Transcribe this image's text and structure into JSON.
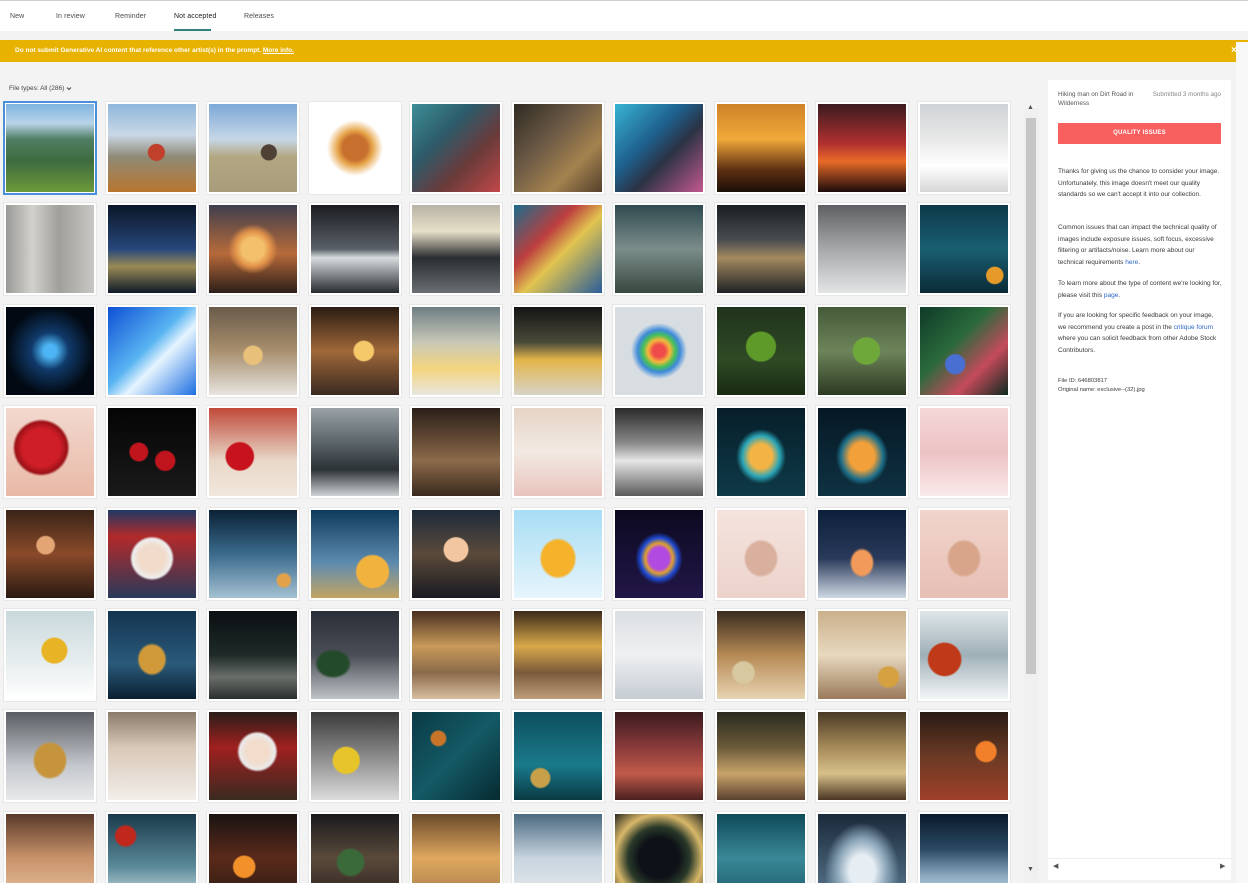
{
  "tabs": [
    {
      "label": "New",
      "active": false
    },
    {
      "label": "In review",
      "active": false
    },
    {
      "label": "Reminder",
      "active": false
    },
    {
      "label": "Not accepted",
      "active": true
    },
    {
      "label": "Releases",
      "active": false
    }
  ],
  "banner": {
    "text": "Do not submit Generative AI content that reference other artist(s) in the prompt.",
    "link": "More info.",
    "close": "×",
    "color": "#e8b200"
  },
  "filter": {
    "label": "File types: All (286)",
    "chevron_icon": "chevron-down-icon"
  },
  "scrollbar": {
    "up_arrow": "▲",
    "down_arrow": "▼"
  },
  "detail": {
    "title": "Hiking man on Dirt Road in Wilderness",
    "submitted": "Submitted 3 months ago",
    "status_button": "QUALITY ISSUES",
    "status_color": "#f86060",
    "p1": "Thanks for giving us the chance to consider your image. Unfortunately, this image doesn't meet our quality standards so we can't accept it into our collection.",
    "p2_text": "Common issues that can impact the technical quality of images include exposure issues, soft focus, excessive filtering or artifacts/noise. Learn more about our technical requirements",
    "p2_link": "here",
    "p3_text": "To learn more about the type of content we're looking for, please visit this",
    "p3_link": "page",
    "p4_a": "If you are looking for specific feedback on your image, we recommend you create a post in the",
    "p4_link": "critique forum",
    "p4_b": "where you can solicit feedback from other Adobe Stock Contributors.",
    "file_id": "File ID: 646803817",
    "original_name": "Original name: exclusive--(32).jpg",
    "scroll_left": "◀",
    "scroll_right": "▶"
  },
  "thumbnails": [
    {
      "subject": "mountain-valley-hiker-dog",
      "bg": "linear-gradient(180deg,#7fb3e0 0%,#b9d4ea 22%,#4f7f63 40%,#3e6b3f 65%,#6c9a3a 100%)"
    },
    {
      "subject": "hiker-with-dog",
      "bg": "radial-gradient(circle at 55% 55%,#c0402c 0 12%,transparent 13%),linear-gradient(180deg,#8fb6dc 0%,#c9d8e6 35%,#8f8a76 60%,#b9762f 100%)"
    },
    {
      "subject": "hiker-on-dirt-road",
      "bg": "radial-gradient(circle at 68% 55%,#4f4135 0 10%,transparent 11%),linear-gradient(180deg,#7da8d8 0%,#c6d7e6 40%,#b3a782 60%,#a79c7c 100%)"
    },
    {
      "subject": "burger-splash",
      "bg": "radial-gradient(circle at 50% 50%,#c7702e 0 20%,#e6a54a 28%,#fff 45%)"
    },
    {
      "subject": "soldier-american-flag",
      "bg": "linear-gradient(135deg,#3d8e96 0%,#2d5b6b 35%,#6a3a3a 65%,#c14848 100%)"
    },
    {
      "subject": "soldier-flag-sepia",
      "bg": "linear-gradient(135deg,#2f2a24 0%,#6d5b45 40%,#a4824f 70%,#54412a 100%)"
    },
    {
      "subject": "soldier-watercolor",
      "bg": "linear-gradient(135deg,#38b4d4 0%,#1e5e8c 40%,#2b3344 60%,#c45890 100%)"
    },
    {
      "subject": "family-sunset-silhouette",
      "bg": "linear-gradient(180deg,#ce8228 0%,#f1a93a 40%,#5d2f12 75%,#1b0f08 100%)"
    },
    {
      "subject": "father-child-sunset",
      "bg": "linear-gradient(180deg,#3b1a1e 0%,#b03030 45%,#e96a28 65%,#1c0c0c 100%)"
    },
    {
      "subject": "man-studio-backdrop",
      "bg": "linear-gradient(180deg,#cfd3d6 0%,#e8e8e8 40%,#ffffff 70%,#d6d6d6 100%)"
    },
    {
      "subject": "wood-snow-backdrop",
      "bg": "linear-gradient(90deg,#9a9a98 0%,#d2d1cd 30%,#a09f9b 60%,#c8c7c3 100%)"
    },
    {
      "subject": "gold-bokeh-water",
      "bg": "linear-gradient(180deg,#0a1628 0%,#27467a 50%,#9a8a55 70%,#0d1a2a 100%)"
    },
    {
      "subject": "crystal-ball-sunset",
      "bg": "radial-gradient(circle at 50% 50%,#f3c06b 0 18%,#e2934a 28%,transparent 40%),linear-gradient(180deg,#3f3f4e 0%,#b76a3a 55%,#2d1f1a 100%)"
    },
    {
      "subject": "fighter-jet",
      "bg": "linear-gradient(180deg,#1a1c20 0%,#5a6068 50%,#d8dde0 60%,#262a2e 100%)"
    },
    {
      "subject": "airliner-runway",
      "bg": "linear-gradient(180deg,#b8b3a5 0%,#e6dfc8 30%,#2a2d31 60%,#6a6e72 100%)"
    },
    {
      "subject": "shipping-containers",
      "bg": "linear-gradient(135deg,#1b6c8c 0%,#bb3e3e 35%,#e2c44f 55%,#2a5d9a 100%)"
    },
    {
      "subject": "old-warplane",
      "bg": "linear-gradient(180deg,#2f4a50 0%,#7b8d8a 50%,#38473f 100%)"
    },
    {
      "subject": "plane-dark-sky",
      "bg": "linear-gradient(180deg,#1a1e22 0%,#4a4d50 40%,#a48a60 60%,#1f2225 100%)"
    },
    {
      "subject": "snow-christmas-stars",
      "bg": "linear-gradient(180deg,#5d5f62 0%,#a6a8aa 50%,#e3e4e5 100%)"
    },
    {
      "subject": "teal-bokeh-gold",
      "bg": "radial-gradient(circle at 85% 80%,#e59a2a 0 8%,transparent 9%),linear-gradient(180deg,#0d3a4a 0%,#1a5e72 50%,#0b2b36 100%)"
    },
    {
      "subject": "blue-light-rings",
      "bg": "radial-gradient(ellipse at 50% 50%,#4db5f5 0 10%,#103a6a 30%,#020912 70%)"
    },
    {
      "subject": "blue-fiber-lights",
      "bg": "linear-gradient(135deg,#0e4fd4 0%,#58b3f2 45%,#e6f5ff 60%,#1d6ee0 100%)"
    },
    {
      "subject": "snow-globe-bokeh",
      "bg": "radial-gradient(circle at 50% 55%,#e8c07a 0 14%,transparent 16%),linear-gradient(180deg,#6a5b4a 0%,#a88f6e 50%,#e7e4df 100%)"
    },
    {
      "subject": "gold-ornament-bokeh",
      "bg": "radial-gradient(circle at 60% 50%,#f5c86a 0 14%,transparent 16%),linear-gradient(180deg,#2a1c12 0%,#a0683a 50%,#3a2a20 100%)"
    },
    {
      "subject": "snowy-trees-forest",
      "bg": "linear-gradient(180deg,#6e7e83 0%,#c8c8b8 40%,#f4d57e 70%,#e8e6df 100%)"
    },
    {
      "subject": "gold-trees-dark",
      "bg": "linear-gradient(180deg,#141414 0%,#4a4a3a 40%,#e3b54a 60%,#d7d3c8 100%)"
    },
    {
      "subject": "rainbow-ornament",
      "bg": "radial-gradient(circle at 50% 50%,#f04b4b 0 10%,#f5b83c 18%,#45c05a 26%,#3d8ad9 34%,#d8dde2 45%)"
    },
    {
      "subject": "moss-heart",
      "bg": "radial-gradient(circle at 50% 45%,#5e9a2a 0 22%,transparent 24%),linear-gradient(180deg,#20331c 0%,#2f4a25 60%,#1a2a14 100%)"
    },
    {
      "subject": "moss-heart-forest",
      "bg": "radial-gradient(circle at 55% 50%,#6ea83a 0 20%,transparent 22%),linear-gradient(180deg,#455a38 0%,#6d845a 50%,#2c3a22 100%)"
    },
    {
      "subject": "pine-ornament",
      "bg": "radial-gradient(circle at 40% 65%,#4a6fd3 0 12%,transparent 14%),linear-gradient(135deg,#0f3a2a 0%,#2a6a3a 40%,#c44a5a 70%,#0c2a1f 100%)"
    },
    {
      "subject": "red-rose",
      "bg": "radial-gradient(circle at 40% 45%,#d01e28 0 26%,#9c1217 36%,transparent 40%),linear-gradient(180deg,#f2d8cf 0%,#e9b9a6 100%)"
    },
    {
      "subject": "roses-dark",
      "bg": "radial-gradient(circle at 35% 50%,#c1151e 0 12%,transparent 14%),radial-gradient(circle at 65% 60%,#c1151e 0 12%,transparent 14%),linear-gradient(180deg,#050505 0%,#1a1a1a 100%)"
    },
    {
      "subject": "rose-bed",
      "bg": "radial-gradient(circle at 35% 55%,#c8121d 0 18%,transparent 20%),linear-gradient(180deg,#c14a3a 0%,#e8d8c8 60%,#f1e7dc 100%)"
    },
    {
      "subject": "snowy-building",
      "bg": "linear-gradient(180deg,#9aa2a6 0%,#5a6368 40%,#2c3236 70%,#cfd3d6 100%)"
    },
    {
      "subject": "horse-carriage",
      "bg": "linear-gradient(180deg,#2a1f18 0%,#6b5038 40%,#8b6a4a 60%,#3a2a1e 100%)"
    },
    {
      "subject": "candles-petals",
      "bg": "linear-gradient(180deg,#e6d4c6 0%,#f2e9e2 50%,#e8c4bd 100%)"
    },
    {
      "subject": "man-paper-bw",
      "bg": "linear-gradient(180deg,#2a2a2a 0%,#8a8a8a 40%,#e6e6e6 60%,#5a5a5a 100%)"
    },
    {
      "subject": "ribbon-christmas-tree",
      "bg": "radial-gradient(ellipse at 50% 55%,#f3b445 0 18%,#2aa6b8 30%,transparent 40%),linear-gradient(180deg,#071e2a 0%,#0e3a48 100%)"
    },
    {
      "subject": "lit-christmas-tree",
      "bg": "radial-gradient(ellipse at 50% 55%,#f2a13a 0 20%,#1c6e8a 34%,transparent 42%),linear-gradient(180deg,#061825 0%,#0f3242 100%)"
    },
    {
      "subject": "pink-room",
      "bg": "linear-gradient(180deg,#f4d8d9 0%,#ecc2c4 50%,#f9eaea 100%)"
    },
    {
      "subject": "girl-with-sparkler",
      "bg": "radial-gradient(circle at 45% 40%,#e3a574 0 12%,transparent 14%),linear-gradient(180deg,#3a2418 0%,#8a4a2a 50%,#2a1a12 100%)"
    },
    {
      "subject": "santa-portrait",
      "bg": "radial-gradient(circle at 50% 55%,#f1dccb 0 20%,#eeeeee 30%,transparent 34%),linear-gradient(180deg,#1f3a64 0%,#b22a2a 30%,#2a3a5a 100%)"
    },
    {
      "subject": "blue-bokeh-snow",
      "bg": "radial-gradient(circle at 85% 80%,#e3a24a 0 6%,transparent 8%),linear-gradient(180deg,#0b2236 0%,#3a6a8c 50%,#a5c1d2 100%)"
    },
    {
      "subject": "gift-box-blue",
      "bg": "radial-gradient(circle at 70% 70%,#f2b23e 0 18%,transparent 20%),linear-gradient(180deg,#0e3b5c 0%,#5d8bb0 60%,#c4a463 100%)"
    },
    {
      "subject": "girl-with-lantern",
      "bg": "radial-gradient(circle at 50% 45%,#f1c6a0 0 18%,transparent 20%),linear-gradient(180deg,#1e2a3a 0%,#5a4a3a 50%,#1a1a22 100%)"
    },
    {
      "subject": "gold-origami-tree",
      "bg": "radial-gradient(ellipse at 50% 55%,#f5b22a 0 26%,transparent 30%),linear-gradient(180deg,#a8ddf4 0%,#e6f5fc 100%)"
    },
    {
      "subject": "neon-tree",
      "bg": "radial-gradient(ellipse at 50% 55%,#b04ae0 0 16%,#e0a030 22%,#1d4ad4 30%,transparent 38%),linear-gradient(180deg,#0c0a20 0%,#221648 100%)"
    },
    {
      "subject": "pink-paper-tree",
      "bg": "radial-gradient(ellipse at 50% 55%,#d9b09e 0 24%,transparent 28%),linear-gradient(180deg,#f4e3dd 0%,#ecd3cb 100%)"
    },
    {
      "subject": "lit-tree-snow",
      "bg": "radial-gradient(ellipse at 50% 60%,#f19a5a 0 16%,transparent 20%),linear-gradient(180deg,#0c1f3a 0%,#2a3a5a 55%,#cfd9e4 100%)"
    },
    {
      "subject": "paper-tree-pink",
      "bg": "radial-gradient(ellipse at 50% 55%,#d8a58a 0 24%,transparent 28%),linear-gradient(180deg,#f1d4cc 0%,#e7bfb4 100%)"
    },
    {
      "subject": "gold-ornament-snow",
      "bg": "radial-gradient(circle at 55% 45%,#e8b426 0 18%,transparent 20%),linear-gradient(180deg,#c9d8dc 0%,#e8eeef 60%,#ffffff 100%)"
    },
    {
      "subject": "gold-tree-blue",
      "bg": "radial-gradient(ellipse at 50% 55%,#d09a3a 0 20%,transparent 24%),linear-gradient(180deg,#133450 0%,#2a5a7a 60%,#0a1f30 100%)"
    },
    {
      "subject": "small-trees-dark",
      "bg": "linear-gradient(180deg,#0b0f12 0%,#1e2a28 50%,#6a6e6a 75%,#2a2e2e 100%)"
    },
    {
      "subject": "tree-night-snow",
      "bg": "radial-gradient(ellipse at 25% 60%,#234a2a 0 16%,transparent 20%),linear-gradient(180deg,#2a2e36 0%,#4a4e56 50%,#bfc4c8 100%)"
    },
    {
      "subject": "gold-bokeh-wood",
      "bg": "linear-gradient(180deg,#4a3020 0%,#c89a5a 40%,#8a6a4a 70%,#d8bfa0 100%)"
    },
    {
      "subject": "gold-bokeh-table",
      "bg": "linear-gradient(180deg,#3a2a1a 0%,#d8a84a 40%,#7a5a3a 70%,#bf9f7a 100%)"
    },
    {
      "subject": "reindeer-snow-forest",
      "bg": "linear-gradient(180deg,#dcdfe2 0%,#eef0f2 50%,#c5ccd2 100%)"
    },
    {
      "subject": "silver-ornaments-bokeh",
      "bg": "radial-gradient(circle at 30% 70%,#d8c8a0 0 12%,transparent 14%),linear-gradient(180deg,#3a2c20 0%,#b58a54 50%,#e8d4b4 100%)"
    },
    {
      "subject": "gold-ornament-wood",
      "bg": "radial-gradient(circle at 80% 75%,#d4a040 0 10%,transparent 12%),linear-gradient(180deg,#cab08a 0%,#e8d8be 50%,#9a7a5a 100%)"
    },
    {
      "subject": "red-ornament-branch",
      "bg": "radial-gradient(circle at 28% 55%,#c03a1a 0 20%,transparent 22%),linear-gradient(180deg,#dfe6e8 0%,#9fb0b8 50%,#f4f6f7 100%)"
    },
    {
      "subject": "gold-tree-ornaments",
      "bg": "radial-gradient(ellipse at 50% 55%,#c6943a 0 24%,transparent 28%),linear-gradient(180deg,#5a5e64 0%,#c3c7cc 60%,#e8e9ea 100%)"
    },
    {
      "subject": "snow-bokeh-frame",
      "bg": "linear-gradient(180deg,#8a7a6a 0%,#d8c8b8 40%,#f2eeea 100%)"
    },
    {
      "subject": "santa-sparkler",
      "bg": "radial-gradient(circle at 55% 45%,#f2dccb 0 16%,#eaeaea 26%,transparent 30%),linear-gradient(180deg,#2a1e18 0%,#a02020 40%,#3a2a20 100%)"
    },
    {
      "subject": "lemons-snow",
      "bg": "radial-gradient(circle at 40% 55%,#e6c42a 0 18%,transparent 20%),linear-gradient(180deg,#3a3a3a 0%,#8a8a8a 50%,#dcdcdc 100%)"
    },
    {
      "subject": "teal-pine-branch",
      "bg": "radial-gradient(circle at 30% 30%,#c8752a 0 8%,transparent 10%),linear-gradient(135deg,#0a3a44 0%,#145a66 50%,#072a30 100%)"
    },
    {
      "subject": "teal-ornaments",
      "bg": "radial-gradient(circle at 30% 75%,#c9a04a 0 10%,transparent 12%),linear-gradient(180deg,#0d4e5e 0%,#1a7a8a 60%,#0a3a44 100%)"
    },
    {
      "subject": "woman-gift-red",
      "bg": "linear-gradient(180deg,#3a1a1e 0%,#8a3a3a 40%,#c05a4a 70%,#4a2020 100%)"
    },
    {
      "subject": "tree-window-bokeh",
      "bg": "linear-gradient(180deg,#2a2a1e 0%,#6a5a3a 40%,#c8a46a 70%,#5a4030 100%)"
    },
    {
      "subject": "gold-lights-room",
      "bg": "linear-gradient(180deg,#4a3a24 0%,#a68a5a 40%,#d8c08a 70%,#4a3624 100%)"
    },
    {
      "subject": "fireplace-gifts",
      "bg": "radial-gradient(circle at 75% 45%,#f2802a 0 12%,transparent 14%),linear-gradient(180deg,#2a1a14 0%,#6a3a24 50%,#a0402a 100%)"
    },
    {
      "subject": "warm-bokeh-frame",
      "bg": "linear-gradient(180deg,#5a3a2a 0%,#c8926a 50%,#e8c4a0 100%)"
    },
    {
      "subject": "red-ornaments-frame",
      "bg": "radial-gradient(circle at 20% 25%,#c0281e 0 10%,transparent 12%),linear-gradient(180deg,#1a3a4a 0%,#5a8a9a 60%,#d8e4e8 100%)"
    },
    {
      "subject": "fireplace-night",
      "bg": "radial-gradient(circle at 40% 60%,#f2902a 0 14%,transparent 16%),linear-gradient(180deg,#1a1412 0%,#5a2a1a 50%,#2a1a12 100%)"
    },
    {
      "subject": "tree-window-night",
      "bg": "radial-gradient(ellipse at 45% 55%,#3a6a3a 0 18%,transparent 22%),linear-gradient(180deg,#1a1a1e 0%,#5a4a3a 50%,#2a2020 100%)"
    },
    {
      "subject": "sparkle-bokeh-gold",
      "bg": "linear-gradient(180deg,#6a4a2a 0%,#e0a860 50%,#a07848 100%)"
    },
    {
      "subject": "cracked-ice",
      "bg": "linear-gradient(180deg,#4a6a80 0%,#c8d4de 50%,#e8ecf0 100%)"
    },
    {
      "subject": "tree-wreath-frame",
      "bg": "radial-gradient(ellipse at 50% 50%,#0e1218 0 32%,#2a3a2a 50%,#d8b86a 70%,#2a2a20 100%)"
    },
    {
      "subject": "teal-bokeh-soft",
      "bg": "linear-gradient(180deg,#0f4a58 0%,#3a8898 50%,#1a5a68 100%)"
    },
    {
      "subject": "frozen-circle-ice",
      "bg": "radial-gradient(ellipse at 50% 65%,#e6eef4 0 20%,#8aa4b8 40%,transparent 60%),linear-gradient(180deg,#1a2a3a 0%,#5a7890 100%)"
    },
    {
      "subject": "snowy-forest-path",
      "bg": "linear-gradient(180deg,#0a1a2a 0%,#2a4a64 40%,#8aa8c0 70%,#d8e4ec 100%)"
    }
  ]
}
